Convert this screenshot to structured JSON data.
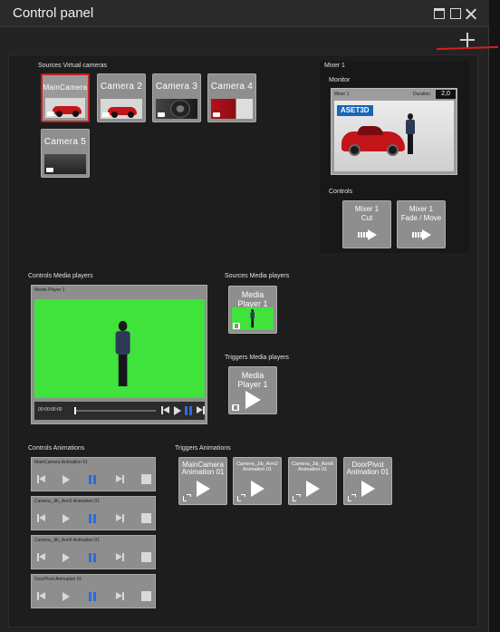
{
  "window": {
    "title": "Control panel"
  },
  "sources_virtual_cameras": {
    "label": "Sources Virtual cameras",
    "cameras": [
      {
        "name": "MainCamera",
        "active": true
      },
      {
        "name": "Camera 2",
        "active": false
      },
      {
        "name": "Camera 3",
        "active": false
      },
      {
        "name": "Camera 4",
        "active": false
      },
      {
        "name": "Camera 5",
        "active": false
      }
    ]
  },
  "mixer": {
    "label": "Mixer 1",
    "monitor_label": "Monitor",
    "monitor": {
      "name": "Mixer 1",
      "duration_label": "Duration",
      "duration_value": "2,0",
      "logo_text": "ASET3D"
    },
    "controls_label": "Controls",
    "buttons": [
      {
        "line1": "Mixer 1",
        "line2": "Cut"
      },
      {
        "line1": "Mixer 1",
        "line2": "Fade / Move"
      }
    ]
  },
  "controls_media_players": {
    "label": "Controls Media players",
    "player": {
      "name": "Media Player 1",
      "timecode": "00:00:00:00"
    }
  },
  "sources_media_players": {
    "label": "Sources Media players",
    "items": [
      {
        "line1": "Media",
        "line2": "Player 1"
      }
    ]
  },
  "triggers_media_players": {
    "label": "Triggers Media players",
    "items": [
      {
        "line1": "Media",
        "line2": "Player 1"
      }
    ]
  },
  "controls_animations": {
    "label": "Controls Animations",
    "items": [
      {
        "name": "MainCamera Animation 01"
      },
      {
        "name": "Camera_Jib_Arm2 Animation 01"
      },
      {
        "name": "Camera_Jib_Arm6 Animation 01"
      },
      {
        "name": "DoorPivot Animation 01"
      }
    ]
  },
  "triggers_animations": {
    "label": "Triggers Animations",
    "items": [
      {
        "line1": "MainCamera",
        "line2": "Animation 01"
      },
      {
        "line1": "Camera_Jib_Arm2",
        "line2": "Animation 01"
      },
      {
        "line1": "Camera_Jib_Arm6",
        "line2": "Animation 01"
      },
      {
        "line1": "DoorPivot",
        "line2": "Animation 01"
      }
    ]
  },
  "colors": {
    "active_border": "#c62020",
    "green_screen": "#3fe33b",
    "pause_blue": "#2a6be0",
    "accent_red_line": "#d61e1e"
  },
  "icons": [
    "minimize-icon",
    "maximize-icon",
    "close-icon",
    "add-icon",
    "arrow-right-icon",
    "play-icon",
    "pause-icon",
    "stop-icon",
    "skip-back-icon",
    "skip-forward-icon",
    "film-icon",
    "camera-icon"
  ]
}
